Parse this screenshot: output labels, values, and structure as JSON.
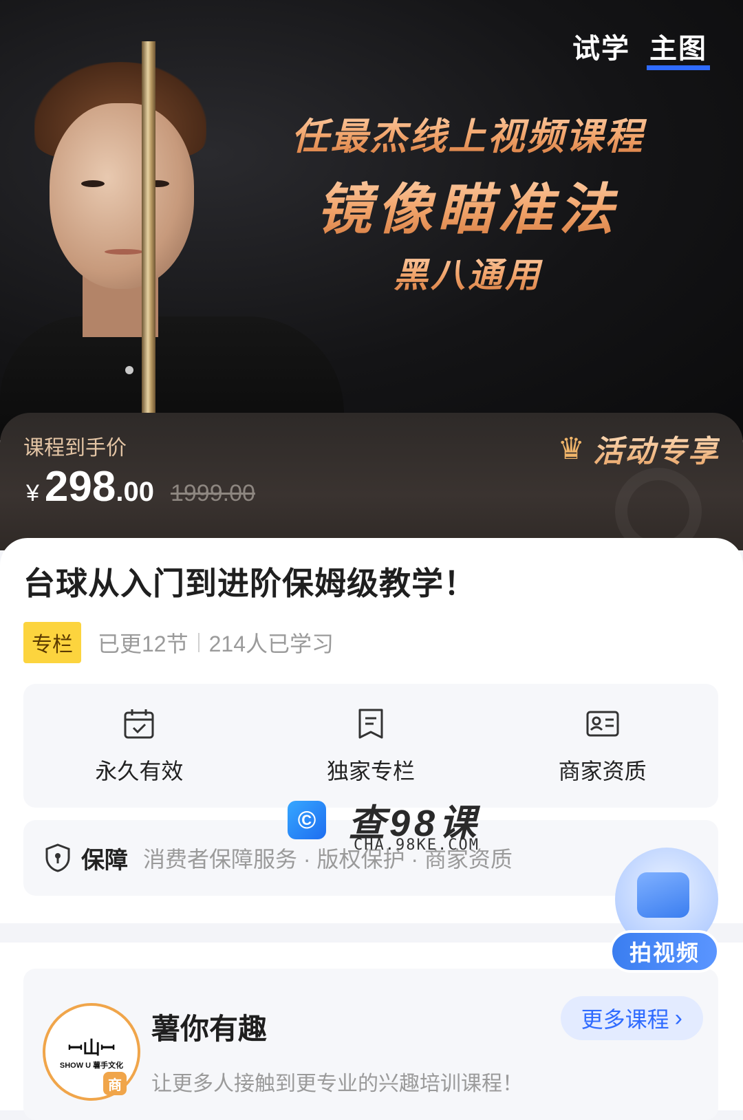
{
  "hero": {
    "tabs": [
      {
        "label": "试学",
        "active": false
      },
      {
        "label": "主图",
        "active": true
      }
    ],
    "title_line1": "任最杰线上视频课程",
    "title_line2": "镜像瞄准法",
    "title_line3": "黑八通用"
  },
  "price": {
    "label": "课程到手价",
    "currency": "¥",
    "integer": "298",
    "decimal": ".00",
    "original": "1999.00",
    "promo_text": "活动专享",
    "promo_icon": "crown-icon"
  },
  "course": {
    "title": "台球从入门到进阶保姆级教学！",
    "tag": "专栏",
    "updated": "已更12节",
    "learners": "214人已学习"
  },
  "features": [
    {
      "icon": "calendar-check-icon",
      "label": "永久有效"
    },
    {
      "icon": "bookmark-icon",
      "label": "独家专栏"
    },
    {
      "icon": "id-card-icon",
      "label": "商家资质"
    }
  ],
  "guarantee": {
    "title": "保障",
    "text": "消费者保障服务 · 版权保护 · 商家资质"
  },
  "watermark": {
    "text": "查98课",
    "sub": "CHA.98KE.COM"
  },
  "video_fab": {
    "label": "拍视频"
  },
  "shop": {
    "name": "薯你有趣",
    "description": "让更多人接触到更专业的兴趣培训课程！",
    "more_label": "更多课程",
    "badge": "商",
    "avatar_mark": "ꟷ山ꟷ",
    "avatar_sub": "SHOW U 薯手文化"
  },
  "colors": {
    "accent_blue": "#2f6bff",
    "tag_yellow": "#fcd43e",
    "hero_gold": "#f1a46b"
  }
}
